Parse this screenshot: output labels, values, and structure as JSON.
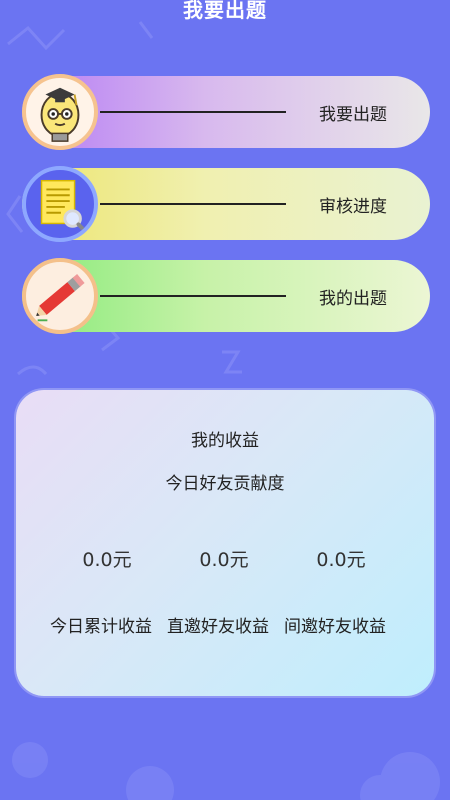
{
  "header": {
    "title": "我要出题"
  },
  "menu": {
    "items": [
      {
        "label": "我要出题",
        "icon": "lightbulb-professor-icon"
      },
      {
        "label": "审核进度",
        "icon": "document-magnifier-icon"
      },
      {
        "label": "我的出题",
        "icon": "pencil-icon"
      }
    ]
  },
  "earnings": {
    "title": "我的收益",
    "subtitle": "今日好友贡献度",
    "amounts": [
      "0.0元",
      "0.0元",
      "0.0元"
    ],
    "labels": [
      "今日累计收益",
      "直邀好友收益",
      "间邀好友收益"
    ]
  },
  "colors": {
    "background": "#6b74f2",
    "menu_1": "#b57bf5",
    "menu_2": "#ece56e",
    "menu_3": "#86ea78",
    "card": "#d9e8f7"
  }
}
